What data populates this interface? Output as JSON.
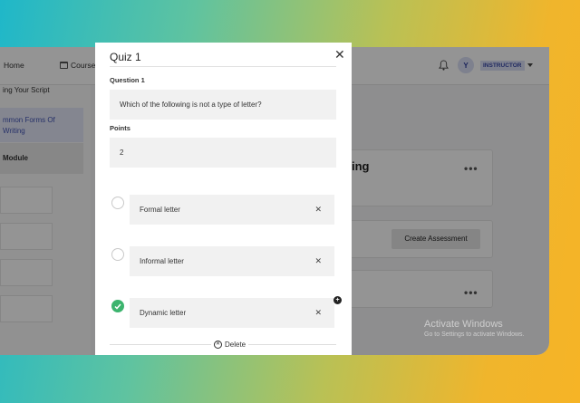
{
  "app": {
    "nav_home": "Home",
    "nav_courses": "Courses",
    "role_badge": "INSTRUCTOR",
    "avatar_initial": "Y"
  },
  "sidebar": {
    "items": [
      {
        "label": "ing Your Script"
      },
      {
        "label": "mmon Forms Of"
      },
      {
        "label": "Writing"
      },
      {
        "label": "Module"
      }
    ]
  },
  "main": {
    "card_title_fragment": "ing",
    "create_assessment_label": "Create Assessment",
    "more_glyph": "•••"
  },
  "watermark": {
    "line1": "Activate Windows",
    "line2": "Go to Settings to activate Windows."
  },
  "modal": {
    "title": "Quiz 1",
    "close_glyph": "✕",
    "question_label": "Question 1",
    "question_text": "Which of the following is not a type of letter?",
    "points_label": "Points",
    "points_value": "2",
    "options": [
      {
        "label": "Formal letter",
        "selected": false
      },
      {
        "label": "Informal letter",
        "selected": false
      },
      {
        "label": "Dynamic letter",
        "selected": true
      }
    ],
    "remove_glyph": "✕",
    "add_glyph": "+",
    "delete_label": "Delete"
  },
  "colors": {
    "accent": "#3cb46e",
    "brand": "#4355b5",
    "overlay": "rgba(0,0,0,0.42)"
  }
}
